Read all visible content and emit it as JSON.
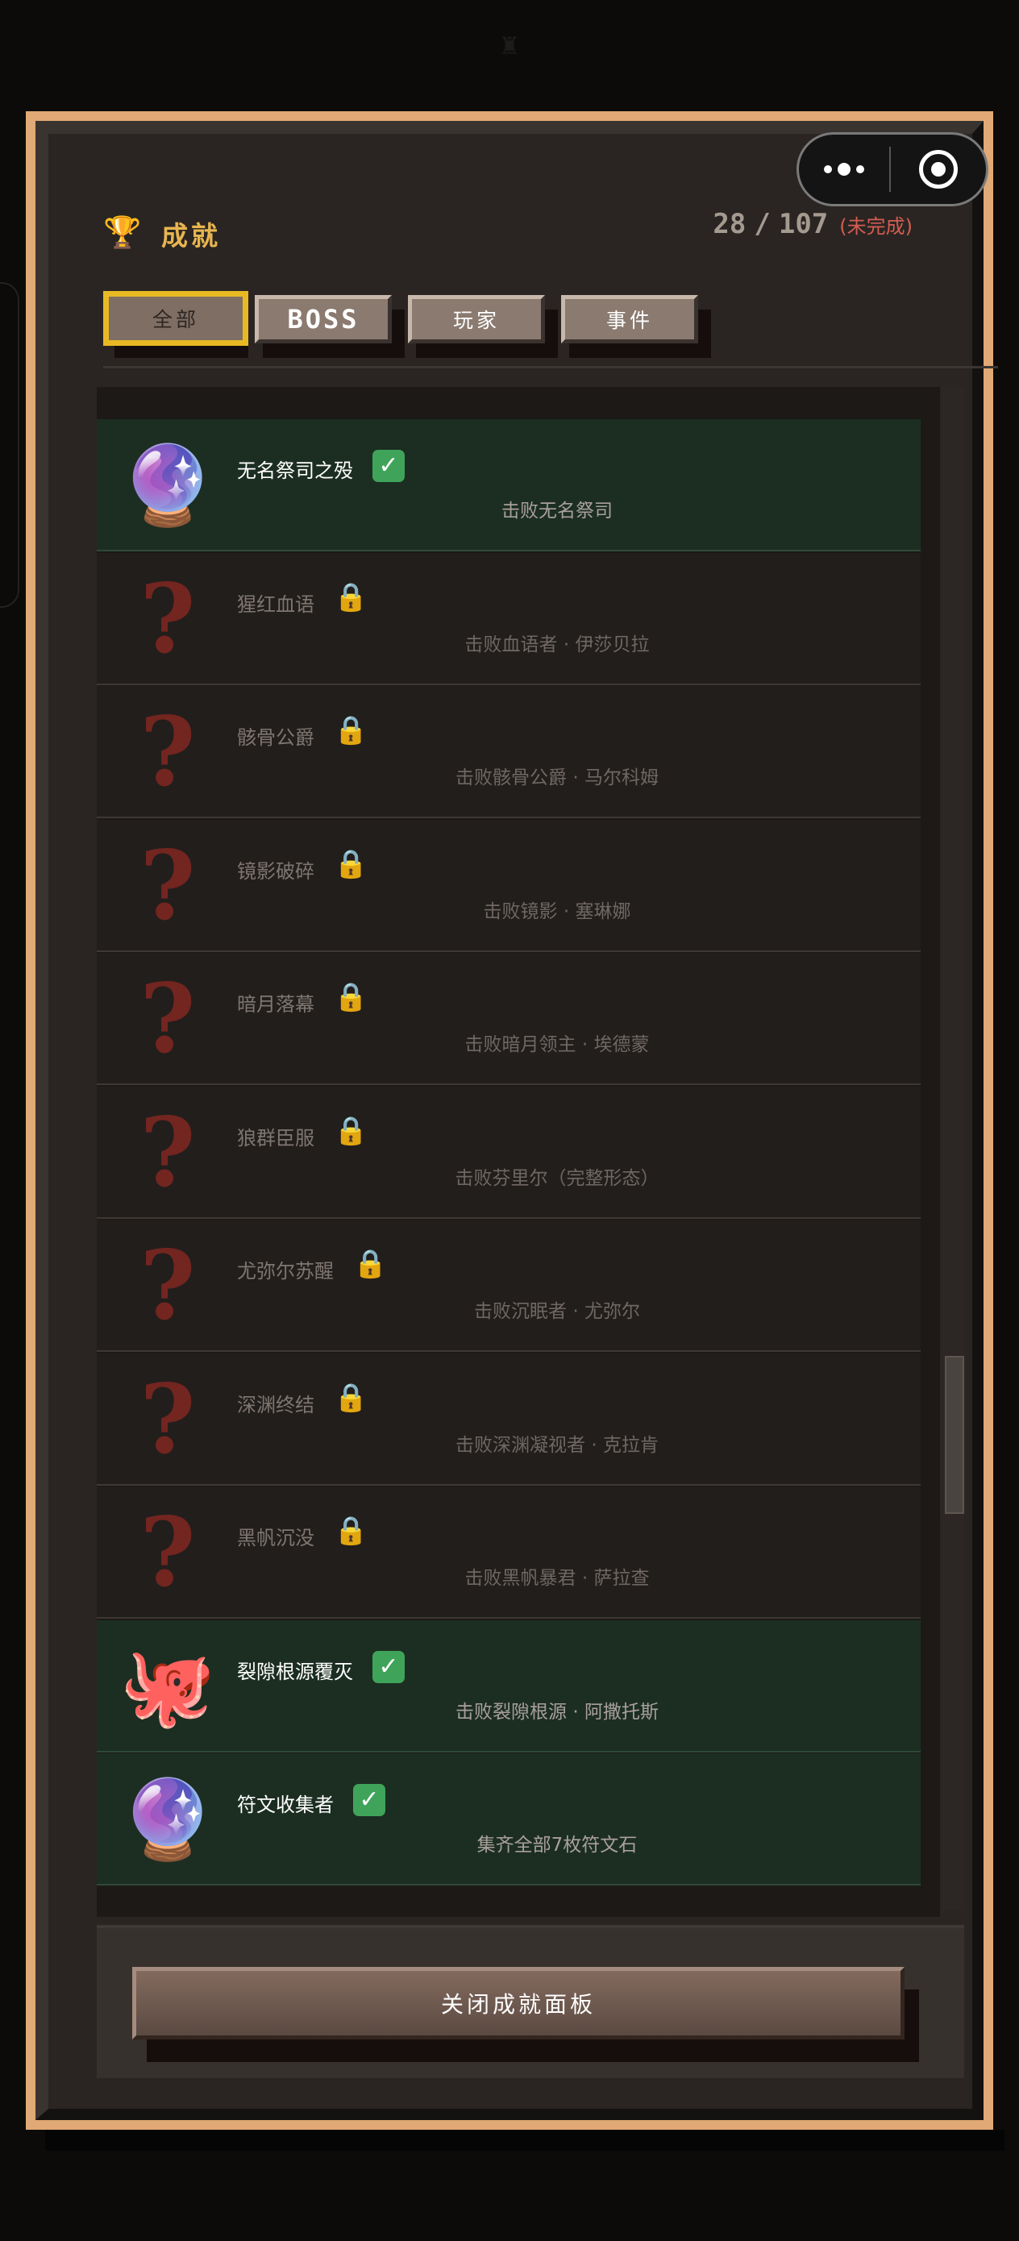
{
  "header": {
    "title": "成就",
    "completed": "28",
    "separator": "/",
    "total": "107",
    "status": "(未完成)"
  },
  "tabs": [
    {
      "label": "全部",
      "active": true
    },
    {
      "label": "BOSS",
      "active": false
    },
    {
      "label": "玩家",
      "active": false
    },
    {
      "label": "事件",
      "active": false
    }
  ],
  "achievements": [
    {
      "name": "无名祭司之殁",
      "desc": "击败无名祭司",
      "unlocked": true,
      "icon": "crystal-ball-icon",
      "glyph": "🔮"
    },
    {
      "name": "猩红血语",
      "desc": "击败血语者 · 伊莎贝拉",
      "unlocked": false,
      "icon": "question-mark-icon",
      "glyph": "?"
    },
    {
      "name": "骸骨公爵",
      "desc": "击败骸骨公爵 · 马尔科姆",
      "unlocked": false,
      "icon": "question-mark-icon",
      "glyph": "?"
    },
    {
      "name": "镜影破碎",
      "desc": "击败镜影 · 塞琳娜",
      "unlocked": false,
      "icon": "question-mark-icon",
      "glyph": "?"
    },
    {
      "name": "暗月落幕",
      "desc": "击败暗月领主 · 埃德蒙",
      "unlocked": false,
      "icon": "question-mark-icon",
      "glyph": "?"
    },
    {
      "name": "狼群臣服",
      "desc": "击败芬里尔（完整形态）",
      "unlocked": false,
      "icon": "question-mark-icon",
      "glyph": "?"
    },
    {
      "name": "尤弥尔苏醒",
      "desc": "击败沉眠者 · 尤弥尔",
      "unlocked": false,
      "icon": "question-mark-icon",
      "glyph": "?"
    },
    {
      "name": "深渊终结",
      "desc": "击败深渊凝视者 · 克拉肯",
      "unlocked": false,
      "icon": "question-mark-icon",
      "glyph": "?"
    },
    {
      "name": "黑帆沉没",
      "desc": "击败黑帆暴君 · 萨拉查",
      "unlocked": false,
      "icon": "question-mark-icon",
      "glyph": "?"
    },
    {
      "name": "裂隙根源覆灭",
      "desc": "击败裂隙根源 · 阿撒托斯",
      "unlocked": true,
      "icon": "octopus-icon",
      "glyph": "🐙"
    },
    {
      "name": "符文收集者",
      "desc": "集齐全部7枚符文石",
      "unlocked": true,
      "icon": "crystal-ball-icon",
      "glyph": "🔮"
    }
  ],
  "icons": {
    "trophy": "trophy-icon",
    "check": "✓",
    "lock": "🔒",
    "unlocked_badge": "check-badge-icon",
    "locked_badge": "lock-icon"
  },
  "colors": {
    "frame": "#e0a975",
    "title": "#e7b54f",
    "incomplete": "#d35d52",
    "unlocked_row": "#1c2e22",
    "locked_row": "#221e1c",
    "active_tab_border": "#e9b924"
  },
  "footer": {
    "close_label": "关闭成就面板"
  }
}
